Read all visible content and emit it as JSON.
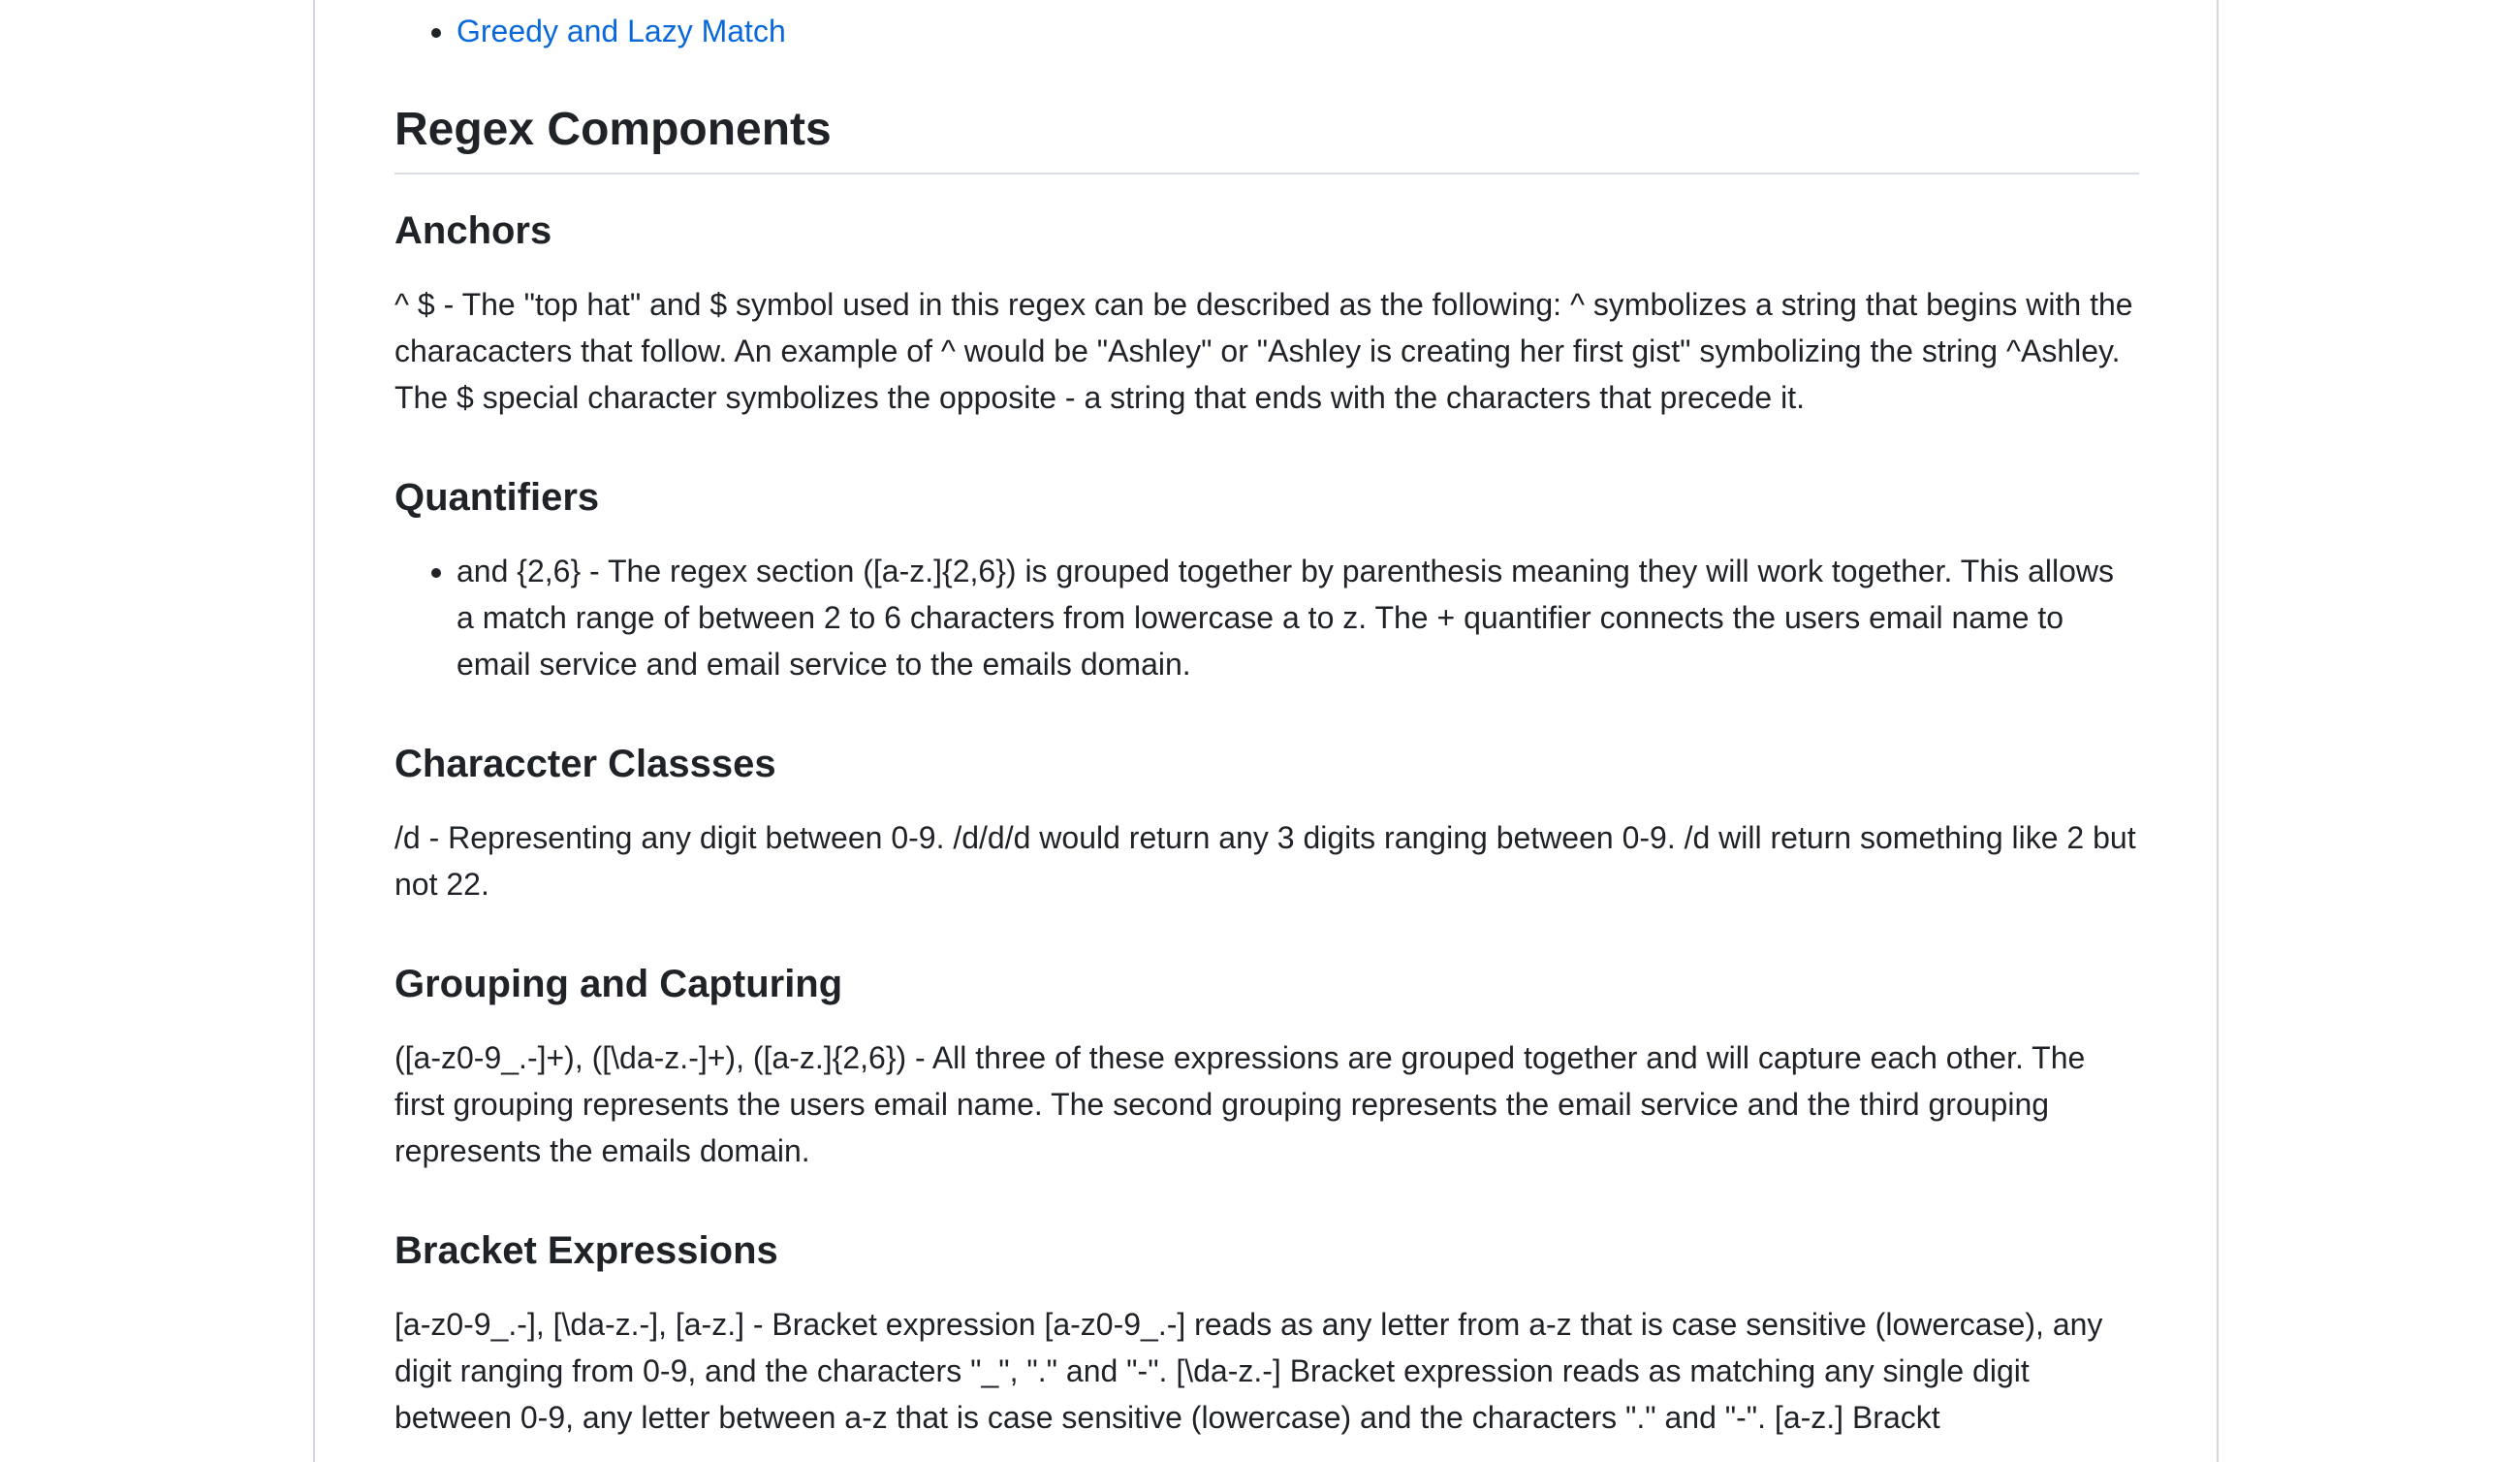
{
  "toc": {
    "link_label": "Greedy and Lazy Match"
  },
  "section": {
    "title": "Regex Components"
  },
  "anchors": {
    "heading": "Anchors",
    "text": "^ $ - The \"top hat\" and $ symbol used in this regex can be described as the following: ^ symbolizes a string that begins with the characacters that follow. An example of ^ would be \"Ashley\" or \"Ashley is creating her first gist\" symbolizing the string ^Ashley. The $ special character symbolizes the opposite - a string that ends with the characters that precede it."
  },
  "quantifiers": {
    "heading": "Quantifiers",
    "item": "and {2,6} - The regex section ([a-z.]{2,6}) is grouped together by parenthesis meaning they will work together. This allows a match range of between 2 to 6 characters from lowercase a to z. The + quantifier connects the users email name to email service and email service to the emails domain."
  },
  "character_classes": {
    "heading": "Characcter Classses",
    "text": "/d - Representing any digit between 0-9. /d/d/d would return any 3 digits ranging between 0-9. /d will return something like 2 but not 22."
  },
  "grouping": {
    "heading": "Grouping and Capturing",
    "text": "([a-z0-9_.-]+), ([\\da-z.-]+), ([a-z.]{2,6}) - All three of these expressions are grouped together and will capture each other. The first grouping represents the users email name. The second grouping represents the email service and the third grouping represents the emails domain."
  },
  "bracket": {
    "heading": "Bracket Expressions",
    "text": "[a-z0-9_.-], [\\da-z.-], [a-z.] - Bracket expression [a-z0-9_.-] reads as any letter from a-z that is case sensitive (lowercase), any digit ranging from 0-9, and the characters \"_\", \".\" and \"-\". [\\da-z.-] Bracket expression reads as matching any single digit between 0-9, any letter between a-z that is case sensitive (lowercase) and the characters \".\" and \"-\". [a-z.] Brackt"
  }
}
